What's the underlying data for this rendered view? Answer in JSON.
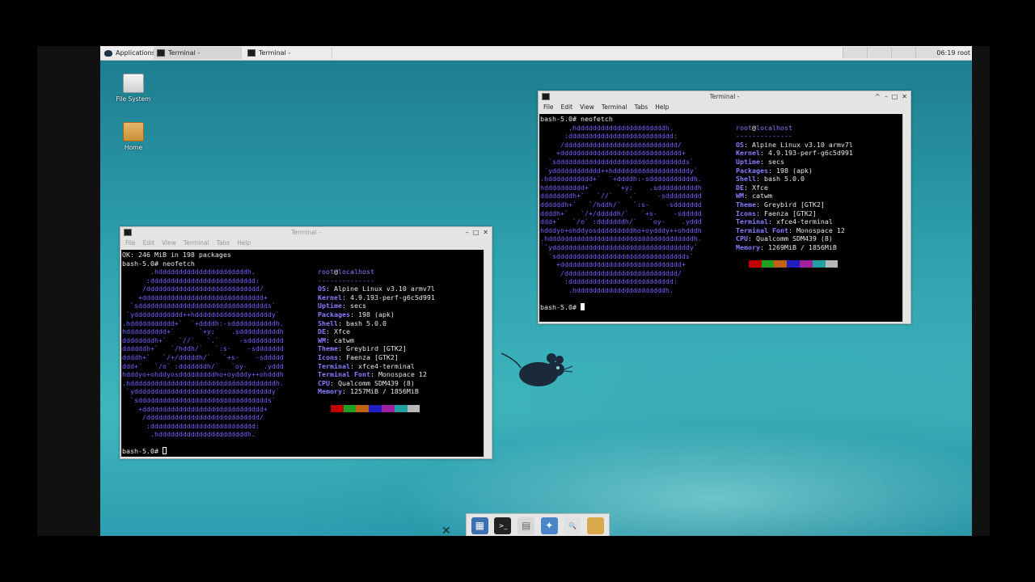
{
  "panel": {
    "applications_label": "Applications",
    "tasks": [
      {
        "label": "Terminal -"
      },
      {
        "label": "Terminal -"
      }
    ],
    "clock": "06:19 root"
  },
  "desktop_icons": [
    {
      "label": "File System",
      "icon": "drive-icon"
    },
    {
      "label": "Home",
      "icon": "folder-icon"
    }
  ],
  "menu": [
    "File",
    "Edit",
    "View",
    "Terminal",
    "Tabs",
    "Help"
  ],
  "window_controls": [
    "^",
    "–",
    "□",
    "✕"
  ],
  "term_left": {
    "title": "Terminal -",
    "line1": "OK: 246 MiB in 198 packages",
    "line2": "bash-5.0# neofetch",
    "prompt": "bash-5.0#",
    "art": [
      "       .hddddddddddddddddddddddh.",
      "      :dddddddddddddddddddddddddd:",
      "     /dddddddddddddddddddddddddddd/",
      "    +dddddddddddddddddddddddddddddd+",
      "  `sdddddddddddddddddddddddddddddddds`",
      " `ydddddddddddd++hdddddddddddddddddddy`",
      ".hddddddddddd+`  `+ddddh:-sdddddddddddh.",
      "hdddddddddd+`      `+y:    .sddddddddddh",
      "ddddddddh+`   `//`   `.`     -sddddddddd",
      "ddddddh+`   `/hddh/`   `:s-    -sddddddd",
      "ddddh+`   `/+/dddddh/`   `+s-    -sddddd",
      "ddd+`   `/o` :dddddddh/`   `oy-    .yddd",
      "hdddyo+ohddyosdddddddddho+oydddy++ohdddh",
      ".hddddddddddddddddddddddddddddddddddddh.",
      " `yddddddddddddddddddddddddddddddddddy`",
      "  `sdddddddddddddddddddddddddddddddds`",
      "    +dddddddddddddddddddddddddddddd+",
      "     /dddddddddddddddddddddddddddd/",
      "      :dddddddddddddddddddddddddd:",
      "       .hddddddddddddddddddddddh."
    ],
    "info": {
      "user": "root",
      "host": "localhost",
      "separator": "--------------",
      "rows": [
        {
          "k": "OS",
          "v": "Alpine Linux v3.10 armv7l"
        },
        {
          "k": "Kernel",
          "v": "4.9.193-perf-g6c5d991"
        },
        {
          "k": "Uptime",
          "v": "secs"
        },
        {
          "k": "Packages",
          "v": "198 (apk)"
        },
        {
          "k": "Shell",
          "v": "bash 5.0.0"
        },
        {
          "k": "DE",
          "v": "Xfce"
        },
        {
          "k": "WM",
          "v": "catwm"
        },
        {
          "k": "Theme",
          "v": "Greybird [GTK2]"
        },
        {
          "k": "Icons",
          "v": "Faenza [GTK2]"
        },
        {
          "k": "Terminal",
          "v": "xfce4-terminal"
        },
        {
          "k": "Terminal Font",
          "v": "Monospace 12"
        },
        {
          "k": "CPU",
          "v": "Qualcomm SDM439 (8)"
        },
        {
          "k": "Memory",
          "v": "1257MiB / 1856MiB"
        }
      ]
    }
  },
  "term_right": {
    "title": "Terminal -",
    "line1": "bash-5.0# neofetch",
    "prompt": "bash-5.0#",
    "info": {
      "user": "root",
      "host": "localhost",
      "separator": "--------------",
      "rows": [
        {
          "k": "OS",
          "v": "Alpine Linux v3.10 armv7l"
        },
        {
          "k": "Kernel",
          "v": "4.9.193-perf-g6c5d991"
        },
        {
          "k": "Uptime",
          "v": "secs"
        },
        {
          "k": "Packages",
          "v": "198 (apk)"
        },
        {
          "k": "Shell",
          "v": "bash 5.0.0"
        },
        {
          "k": "DE",
          "v": "Xfce"
        },
        {
          "k": "WM",
          "v": "catwm"
        },
        {
          "k": "Theme",
          "v": "Greybird [GTK2]"
        },
        {
          "k": "Icons",
          "v": "Faenza [GTK2]"
        },
        {
          "k": "Terminal",
          "v": "xfce4-terminal"
        },
        {
          "k": "Terminal Font",
          "v": "Monospace 12"
        },
        {
          "k": "CPU",
          "v": "Qualcomm SDM439 (8)"
        },
        {
          "k": "Memory",
          "v": "1269MiB / 1856MiB"
        }
      ]
    }
  },
  "swatch_colors": [
    "#000000",
    "#c00000",
    "#20a020",
    "#c06010",
    "#2020c0",
    "#a020a0",
    "#20a0a0",
    "#b8b8b8"
  ],
  "dock_items": [
    {
      "name": "show-desktop-icon",
      "glyph": "▦"
    },
    {
      "name": "terminal-icon",
      "glyph": ">_"
    },
    {
      "name": "file-manager-icon",
      "glyph": "▤"
    },
    {
      "name": "web-browser-icon",
      "glyph": "✦"
    },
    {
      "name": "app-finder-icon",
      "glyph": "🔍"
    },
    {
      "name": "folder-icon",
      "glyph": ""
    }
  ],
  "colors": {
    "accent": "#7a63ff",
    "desktop": "#2fa3b0",
    "terminal_bg": "#000000"
  }
}
